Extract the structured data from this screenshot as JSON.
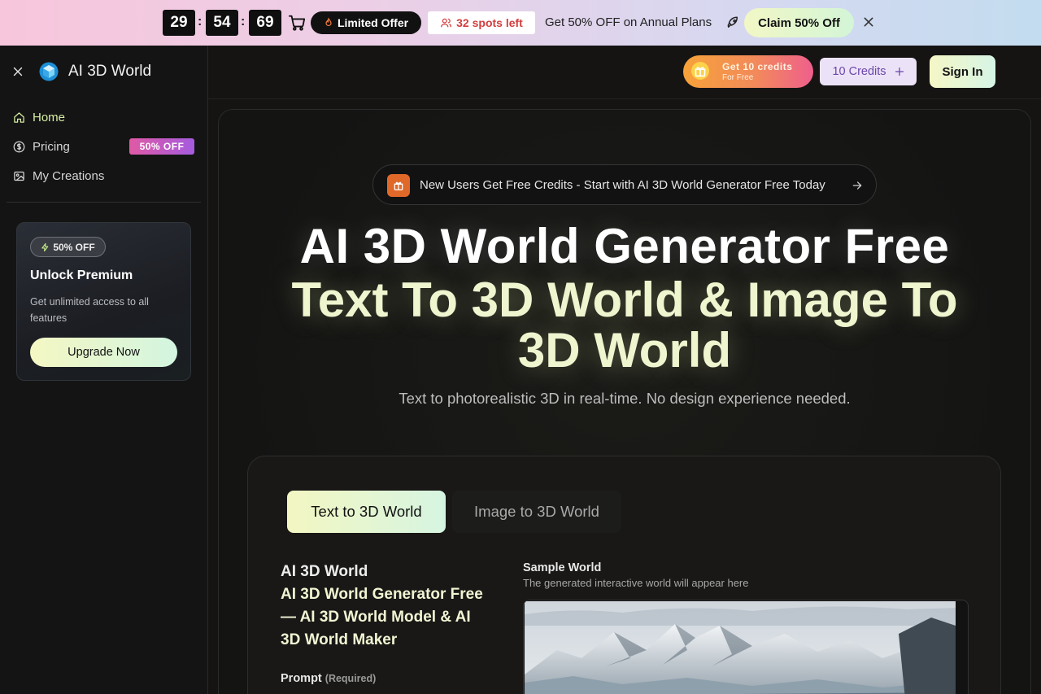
{
  "promo_bar": {
    "timer": {
      "hours": "29",
      "minutes": "54",
      "seconds": "69",
      "separator": ":"
    },
    "limited_offer": "Limited Offer",
    "spots_left": "32 spots left",
    "annual_text": "Get 50% OFF on Annual Plans",
    "claim_button": "Claim 50% Off",
    "icons": [
      "cart-icon",
      "flame-icon",
      "users-icon",
      "rocket-icon",
      "close-icon"
    ]
  },
  "sidebar": {
    "brand": "AI 3D World",
    "nav": [
      {
        "label": "Home",
        "icon": "home-icon",
        "active": true
      },
      {
        "label": "Pricing",
        "icon": "dollar-circle-icon",
        "badge": "50% OFF"
      },
      {
        "label": "My Creations",
        "icon": "image-icon"
      }
    ],
    "premium": {
      "badge": "50% OFF",
      "title": "Unlock Premium",
      "description": "Get unlimited access to all features",
      "button": "Upgrade Now"
    }
  },
  "header": {
    "credits_promo": {
      "line1": "Get 10 credits",
      "line2": "For Free"
    },
    "credits_button": "10 Credits",
    "signin_button": "Sign In"
  },
  "hero": {
    "announcement": "New Users Get Free Credits - Start with AI 3D World Generator Free Today",
    "title_line1": "AI 3D World Generator Free",
    "title_line2": "Text To 3D World & Image To 3D World",
    "subtitle": "Text to photorealistic 3D in real-time. No design experience needed."
  },
  "generator": {
    "tabs": [
      {
        "label": "Text to 3D World",
        "active": true
      },
      {
        "label": "Image to 3D World",
        "active": false
      }
    ],
    "heading_line1": "AI 3D World",
    "heading_line2": "AI 3D World Generator Free — AI 3D World Model & AI 3D World Maker",
    "prompt_label": "Prompt",
    "prompt_required": "(Required)",
    "sample_title": "Sample World",
    "sample_desc": "The generated interactive world will appear here"
  },
  "colors": {
    "accent_gradient_start": "#f4f7c3",
    "accent_gradient_end": "#d3f5e0",
    "background": "#151413",
    "badge_pink": "#e05aa5",
    "badge_purple": "#a55bdf",
    "promo_pink": "#f7c6dc",
    "promo_blue": "#c3dcef"
  }
}
